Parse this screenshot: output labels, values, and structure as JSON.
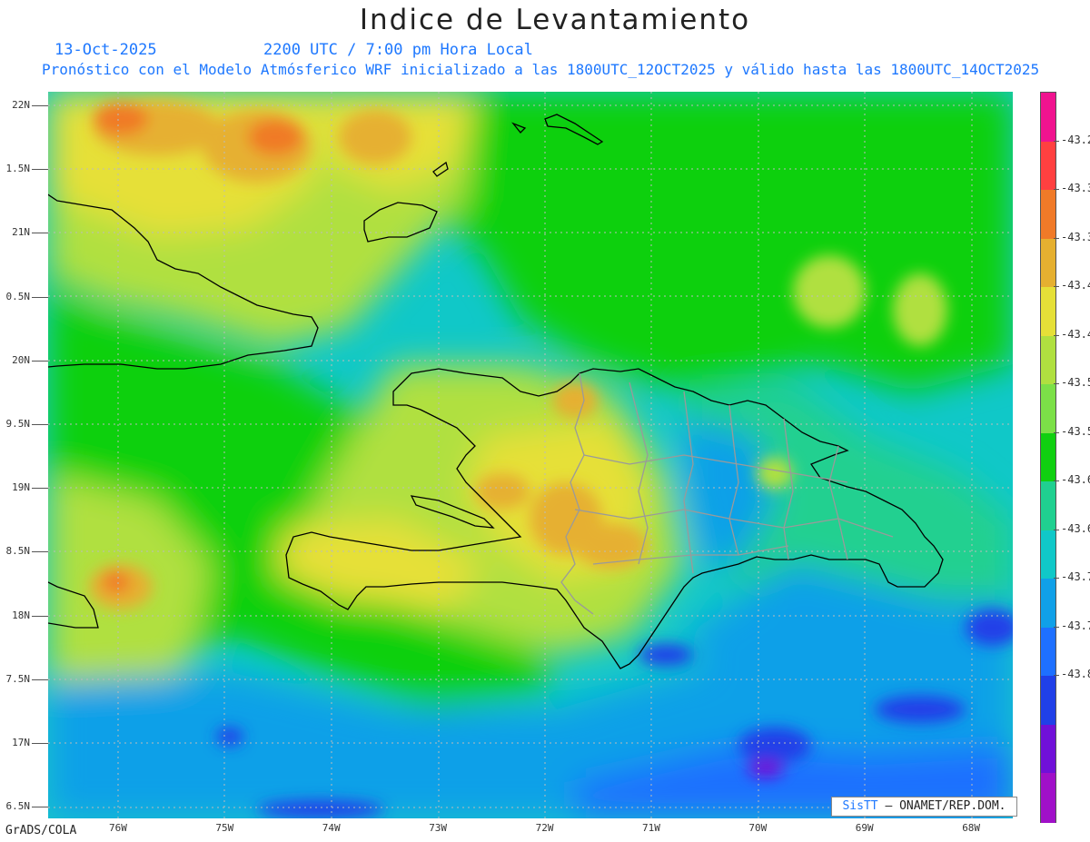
{
  "header": {
    "title": "Indice de Levantamiento",
    "date": "13-Oct-2025",
    "time": "2200 UTC / 7:00 pm Hora Local",
    "description": "Pronóstico con el Modelo Atmósferico WRF inicializado a las 1800UTC_12OCT2025 y válido hasta las  1800UTC_14OCT2025"
  },
  "axes": {
    "lat_labels": [
      "22N",
      "1.5N",
      "21N",
      "0.5N",
      "20N",
      "9.5N",
      "19N",
      "8.5N",
      "18N",
      "7.5N",
      "17N",
      "6.5N"
    ],
    "lon_labels": [
      "76W",
      "75W",
      "74W",
      "73W",
      "72W",
      "71W",
      "70W",
      "69W",
      "68W"
    ]
  },
  "colorbar": {
    "colors": [
      "#f0138f",
      "#ff4040",
      "#f07a28",
      "#e6b030",
      "#e6e038",
      "#b0e040",
      "#7ce048",
      "#10d010",
      "#20d090",
      "#10c8c8",
      "#10a0e8",
      "#1e70ff",
      "#2040e8",
      "#7010d8",
      "#a010c8"
    ],
    "labels": [
      "-43.2",
      "-43.3",
      "-43.3",
      "-43.4",
      "-43.4",
      "-43.5",
      "-43.5",
      "-43.6",
      "-43.6",
      "-43.7",
      "-43.7",
      "-43.8"
    ]
  },
  "footer": {
    "credit_brand": "SisTT",
    "credit_text": "– ONAMET/REP.DOM.",
    "software": "GrADS/COLA"
  }
}
